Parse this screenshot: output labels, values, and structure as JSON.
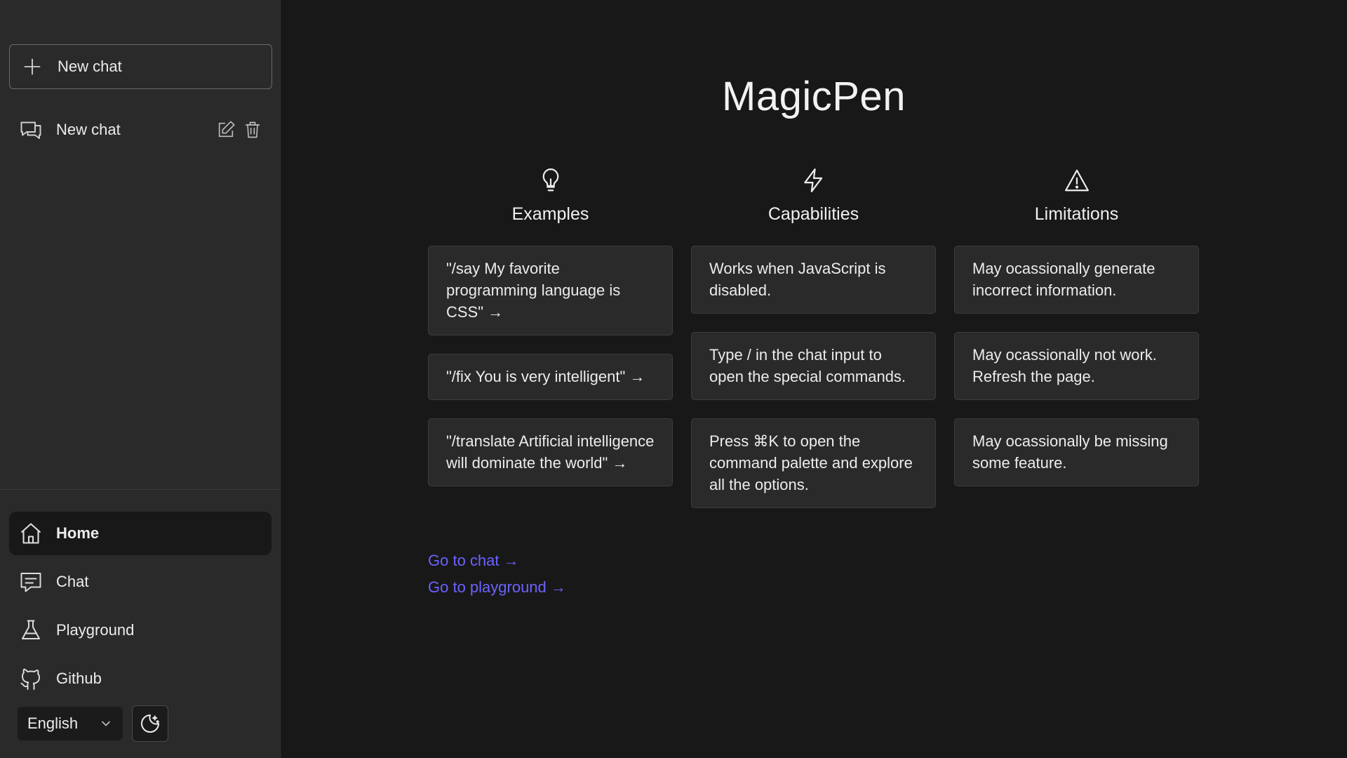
{
  "sidebar": {
    "new_chat_button": "New chat",
    "chats": [
      {
        "label": "New chat"
      }
    ],
    "nav": [
      {
        "label": "Home",
        "icon": "home-icon"
      },
      {
        "label": "Chat",
        "icon": "chat-icon"
      },
      {
        "label": "Playground",
        "icon": "flask-icon"
      },
      {
        "label": "Github",
        "icon": "github-icon"
      }
    ],
    "language": "English"
  },
  "main": {
    "title": "MagicPen",
    "columns": [
      {
        "heading": "Examples",
        "icon": "lightbulb-icon",
        "cards": [
          "\"/say My favorite programming language is CSS\" →",
          "\"/fix You is very intelligent\" →",
          "\"/translate Artificial intelligence will dominate the world\" →"
        ]
      },
      {
        "heading": "Capabilities",
        "icon": "lightning-icon",
        "cards": [
          "Works when JavaScript is disabled.",
          "Type / in the chat input to open the special commands.",
          "Press ⌘K to open the command palette and explore all the options."
        ]
      },
      {
        "heading": "Limitations",
        "icon": "warning-icon",
        "cards": [
          "May ocassionally generate incorrect information.",
          "May ocassionally not work. Refresh the page.",
          "May ocassionally be missing some feature."
        ]
      }
    ],
    "links": [
      "Go to chat →",
      "Go to playground →"
    ]
  },
  "colors": {
    "sidebar_bg": "#2a2a2a",
    "main_bg": "#181818",
    "card_bg": "#2a2a2a",
    "link": "#6c63ff"
  }
}
